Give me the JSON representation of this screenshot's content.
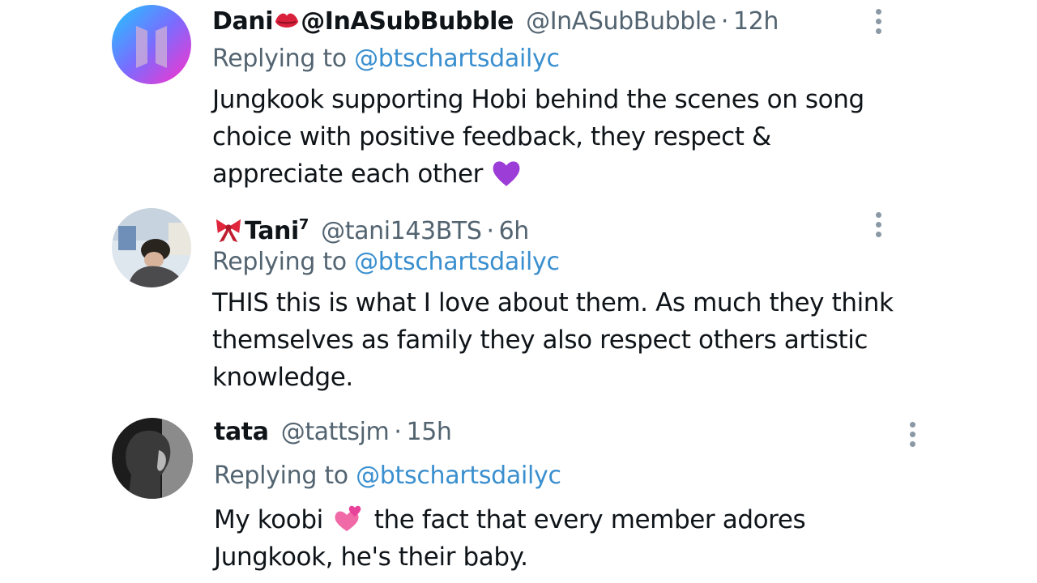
{
  "replies": [
    {
      "name": "Dani",
      "name_suffix": "@InASubBubble",
      "handle": "@InASubBubble",
      "time": "12h",
      "replying_label": "Replying to",
      "replying_to": "@btschartsdailyc",
      "text": "Jungkook supporting Hobi behind the scenes on song choice with positive feedback, they respect & appreciate each other",
      "name_emoji": "kiss-lips-icon",
      "text_emoji": "purple-heart-icon"
    },
    {
      "name": "Tani",
      "name_superscript": "7",
      "handle": "@tani143BTS",
      "time": "6h",
      "replying_label": "Replying to",
      "replying_to": "@btschartsdailyc",
      "text": "THIS this is what I love about them. As much they think themselves as family they also respect others artistic knowledge.",
      "name_emoji": "ribbon-icon"
    },
    {
      "name": "tata",
      "handle": "@tattsjm",
      "time": "15h",
      "replying_label": "Replying to",
      "replying_to": "@btschartsdailyc",
      "text_before": "My koobi",
      "text_after": " the fact that every member adores Jungkook, he's their baby.",
      "text_emoji": "two-hearts-icon"
    }
  ],
  "dot_separator": "·",
  "colors": {
    "text": "#0f1419",
    "secondary": "#536471",
    "mention": "#3a8fcf"
  }
}
